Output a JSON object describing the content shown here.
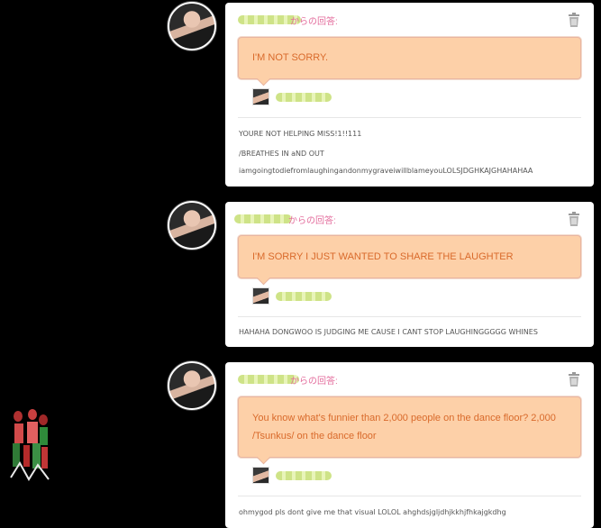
{
  "label_suffix": "からの回答:",
  "posts": [
    {
      "bubble": "I'M NOT SORRY.",
      "replies": [
        "YOURE NOT HELPING MISS!1!!111",
        "/BREATHES IN aND OUT",
        "iamgoingtodiefromlaughingandonmygraveiwillblameyouLOLSJDGHKAJGHAHAHAA"
      ]
    },
    {
      "bubble": "I'M SORRY I JUST WANTED TO SHARE THE LAUGHTER",
      "replies": [
        "HAHAHA DONGWOO IS JUDGING ME CAUSE I CANT STOP LAUGHINGGGGG WHINES"
      ]
    },
    {
      "bubble": "You know what's funnier than 2,000 people on the dance floor? 2,000 /Tsunkus/ on the dance floor",
      "replies": [
        "ohmygod pls dont give me that visual LOLOL ahghdsjgljdhjkkhjfhkajgkdhg"
      ]
    }
  ],
  "icons": {
    "avatar": "avatar-image",
    "trash": "trash-icon",
    "mini_avatar": "mini-avatar-image",
    "fanart": "fanart-image"
  },
  "colors": {
    "background": "#000000",
    "label": "#e36c9c",
    "bubble_fill": "#fdd0a8",
    "bubble_text": "#d96a2b"
  }
}
